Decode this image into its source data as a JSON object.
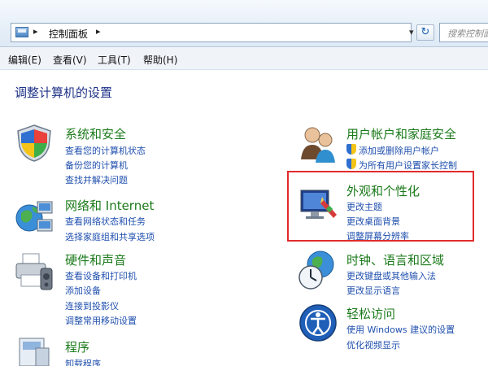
{
  "address": {
    "path": "控制面板",
    "search_placeholder": "搜索控制面"
  },
  "menu": [
    "编辑(E)",
    "查看(V)",
    "工具(T)",
    "帮助(H)"
  ],
  "heading": "调整计算机的设置",
  "categories": [
    {
      "title": "系统和安全",
      "icon": "shield-icon",
      "links": [
        "查看您的计算机状态",
        "备份您的计算机",
        "查找并解决问题"
      ]
    },
    {
      "title": "网络和 Internet",
      "icon": "network-globe-icon",
      "links": [
        "查看网络状态和任务",
        "选择家庭组和共享选项"
      ]
    },
    {
      "title": "硬件和声音",
      "icon": "printer-icon",
      "links": [
        "查看设备和打印机",
        "添加设备",
        "连接到投影仪",
        "调整常用移动设置"
      ]
    },
    {
      "title": "程序",
      "icon": "programs-icon",
      "links": [
        "卸载程序"
      ]
    },
    {
      "title": "用户帐户和家庭安全",
      "icon": "users-icon",
      "links": [
        "添加或删除用户帐户",
        "为所有用户设置家长控制"
      ]
    },
    {
      "title": "外观和个性化",
      "icon": "appearance-icon",
      "links": [
        "更改主题",
        "更改桌面背景",
        "调整屏幕分辨率"
      ]
    },
    {
      "title": "时钟、语言和区域",
      "icon": "clock-globe-icon",
      "links": [
        "更改键盘或其他输入法",
        "更改显示语言"
      ]
    },
    {
      "title": "轻松访问",
      "icon": "ease-of-access-icon",
      "links": [
        "使用 Windows 建议的设置",
        "优化视频显示"
      ]
    }
  ]
}
